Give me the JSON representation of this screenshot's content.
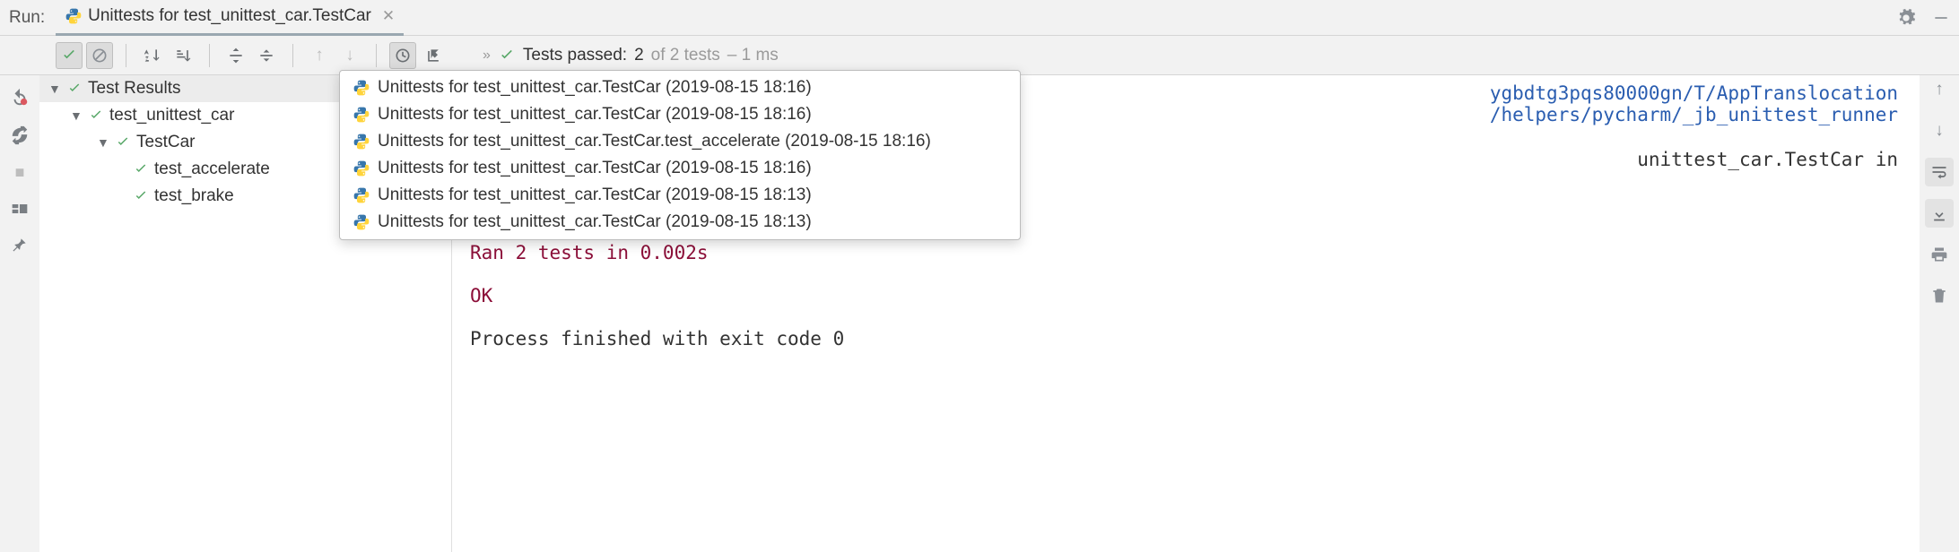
{
  "header": {
    "run_label": "Run:",
    "tab_title": "Unittests for test_unittest_car.TestCar"
  },
  "toolbar": {
    "summary_prefix": "Tests passed:",
    "summary_passed": "2",
    "summary_of": "of 2 tests",
    "summary_time": "– 1 ms"
  },
  "tree": {
    "root": "Test Results",
    "module": "test_unittest_car",
    "class": "TestCar",
    "tests": [
      "test_accelerate",
      "test_brake"
    ]
  },
  "history": [
    "Unittests for test_unittest_car.TestCar (2019-08-15 18:16)",
    "Unittests for test_unittest_car.TestCar (2019-08-15 18:16)",
    "Unittests for test_unittest_car.TestCar.test_accelerate (2019-08-15 18:16)",
    "Unittests for test_unittest_car.TestCar (2019-08-15 18:16)",
    "Unittests for test_unittest_car.TestCar (2019-08-15 18:13)",
    "Unittests for test_unittest_car.TestCar (2019-08-15 18:13)"
  ],
  "console": {
    "path1": "ygbdtg3pqs80000gn/T/AppTranslocation",
    "path2": "/helpers/pycharm/_jb_unittest_runner",
    "more": "unittest_car.TestCar in",
    "ran": "Ran 2 tests in 0.002s",
    "ok": "OK",
    "exit": "Process finished with exit code 0"
  }
}
